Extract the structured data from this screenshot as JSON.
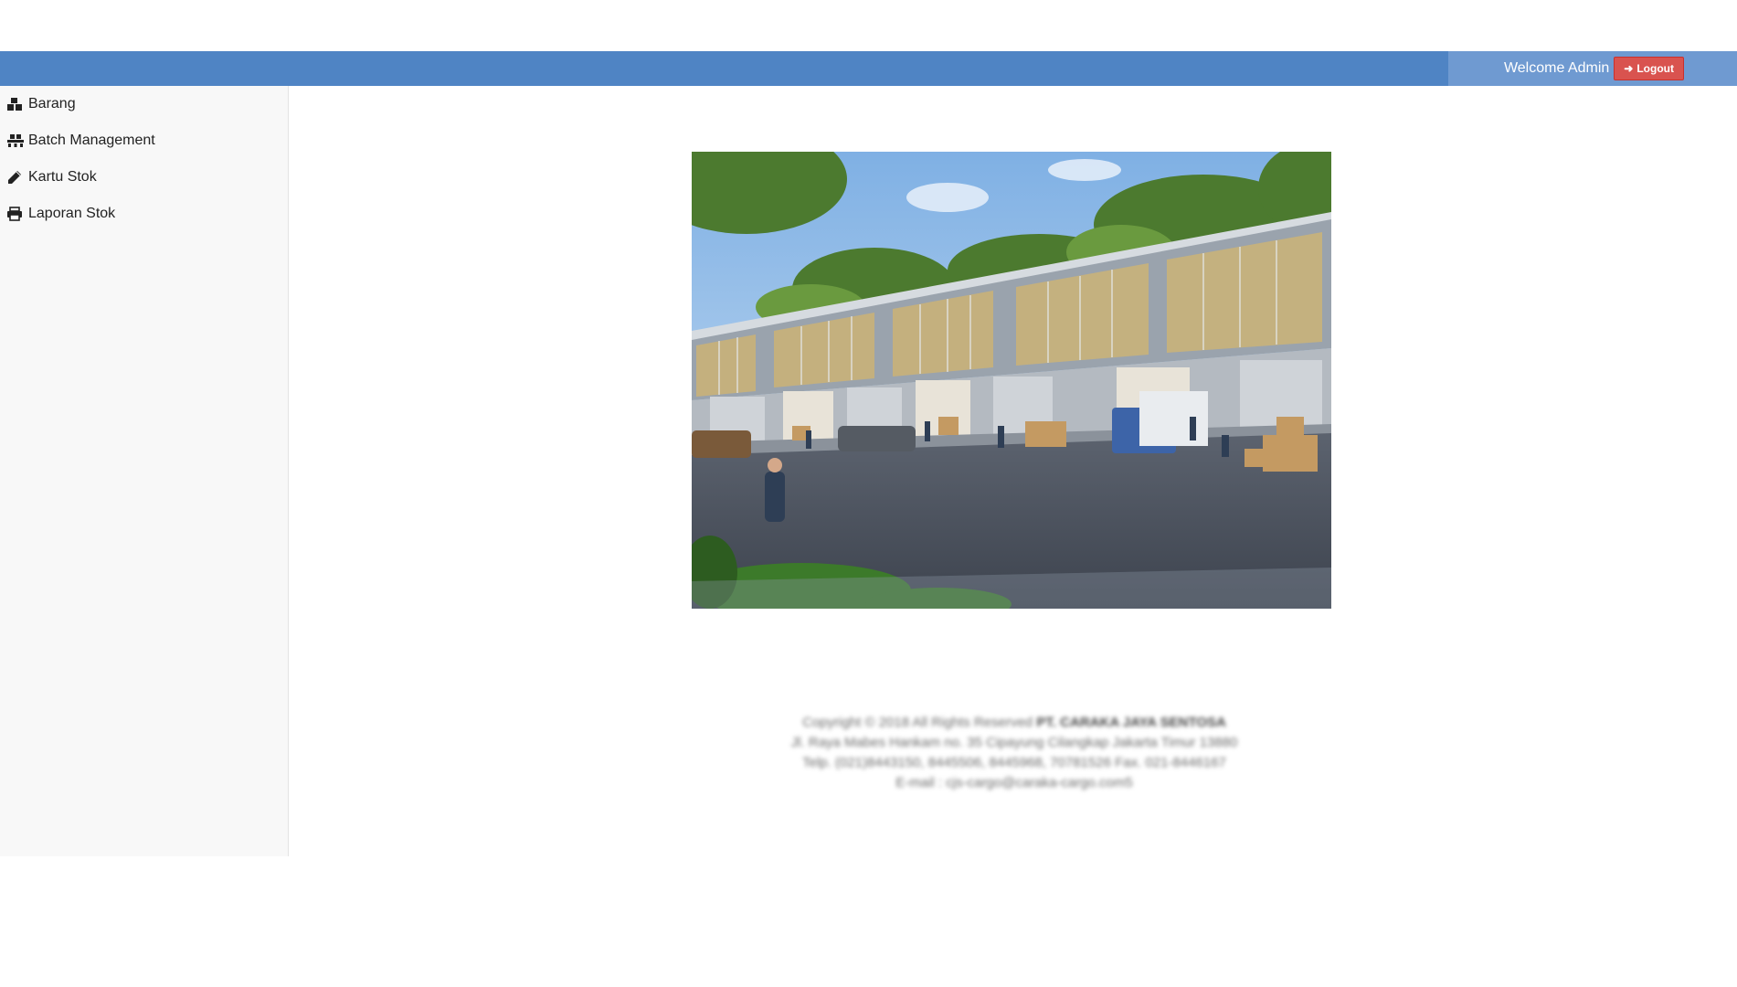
{
  "header": {
    "welcome_text": "Welcome Admin",
    "logout_label": "Logout",
    "logout_icon": "sign-out-icon",
    "bar_color": "#4f84c4",
    "logout_color": "#d9534f"
  },
  "sidebar": {
    "items": [
      {
        "label": "Barang",
        "icon": "cubes-icon"
      },
      {
        "label": "Batch Management",
        "icon": "pallet-icon"
      },
      {
        "label": "Kartu Stok",
        "icon": "pencil-icon"
      },
      {
        "label": "Laporan Stok",
        "icon": "printer-icon"
      }
    ]
  },
  "footer": {
    "copyright": "Copyright © 2018 All Rights Reserved",
    "company": "PT. CARAKA JAYA SENTOSA",
    "address": "Jl. Raya Mabes Hankam no. 35 Cipayung Cilangkap Jakarta Timur 13880",
    "phone": "Telp. (021)8443150, 8445506, 8445968, 70781526 Fax. 021-8446167",
    "email": "E-mail : cjs-cargo@caraka-cargo.com5"
  }
}
